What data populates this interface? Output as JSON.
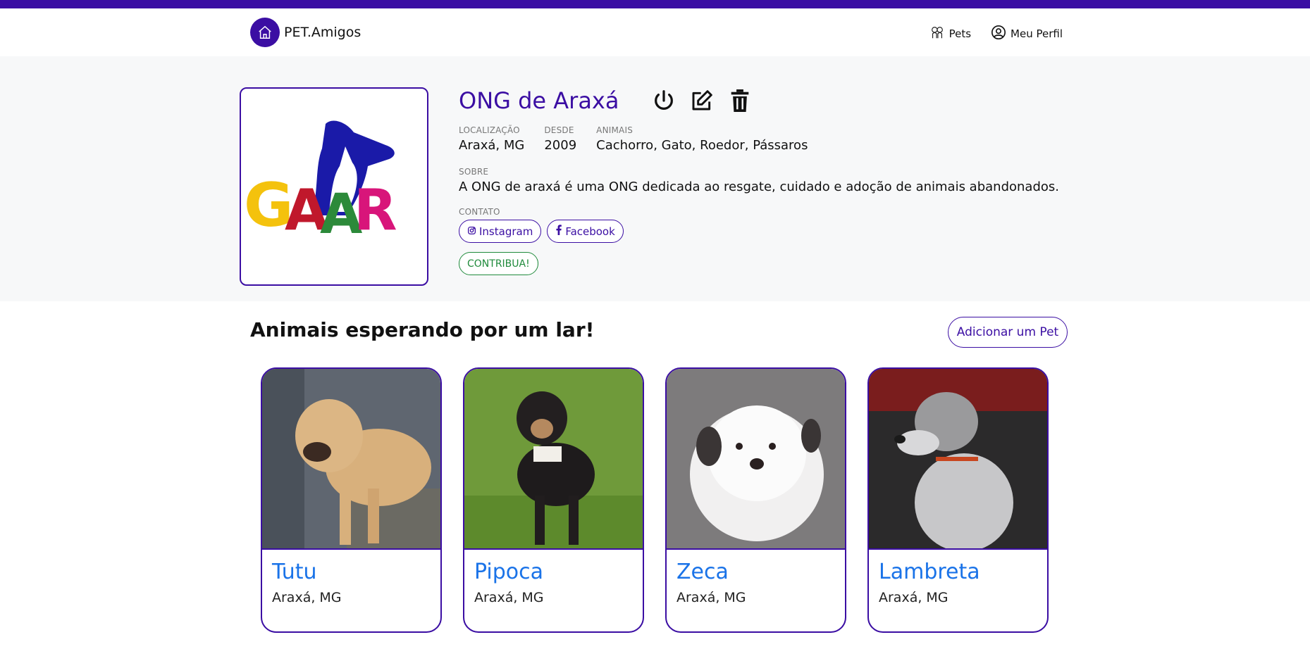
{
  "navbar": {
    "brand": "PET.Amigos",
    "links": [
      {
        "label": "Pets",
        "icon": "dogs-icon"
      },
      {
        "label": "Meu Perfil",
        "icon": "user-circle-icon"
      }
    ]
  },
  "profile": {
    "name": "ONG de Araxá",
    "logo_text": "GAAR",
    "fields": [
      {
        "label": "LOCALIZAÇÃO",
        "value": "Araxá, MG"
      },
      {
        "label": "DESDE",
        "value": "2009"
      },
      {
        "label": "ANIMAIS",
        "value": "Cachorro, Gato, Roedor, Pássaros"
      }
    ],
    "about_label": "SOBRE",
    "about": "A ONG de araxá é uma ONG dedicada ao resgate, cuidado e adoção de animais abandonados.",
    "contact_label": "CONTATO",
    "contacts": [
      {
        "label": "Instagram",
        "icon": "instagram-icon"
      },
      {
        "label": "Facebook",
        "icon": "facebook-icon"
      }
    ],
    "contribute": "CONTRIBUA!"
  },
  "pets_section": {
    "title": "Animais esperando por um lar!",
    "add_button": "Adicionar um Pet",
    "pets": [
      {
        "name": "Tutu",
        "location": "Araxá, MG"
      },
      {
        "name": "Pipoca",
        "location": "Araxá, MG"
      },
      {
        "name": "Zeca",
        "location": "Araxá, MG"
      },
      {
        "name": "Lambreta",
        "location": "Araxá, MG"
      }
    ]
  },
  "colors": {
    "brand": "#3b0ea3",
    "pet_name": "#1a73e8",
    "contribute": "#1f8a3b",
    "hero_bg": "#f7f8f9"
  }
}
